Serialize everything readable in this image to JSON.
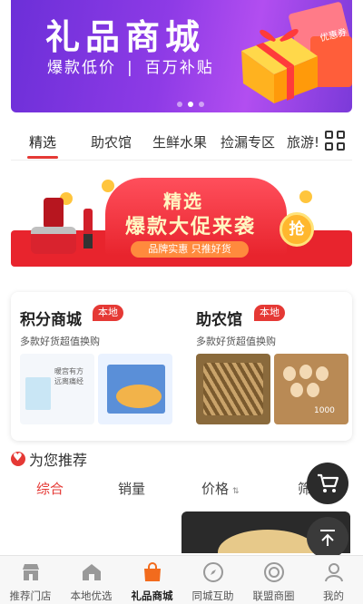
{
  "hero": {
    "title": "礼品商城",
    "subtitle_left": "爆款低价",
    "subtitle_sep": "|",
    "subtitle_right": "百万补贴",
    "ticket_text": "优惠券",
    "slide_count": 3,
    "active_slide": 2
  },
  "tabs": {
    "items": [
      {
        "label": "精选"
      },
      {
        "label": "助农馆"
      },
      {
        "label": "生鲜水果"
      },
      {
        "label": "捡漏专区"
      },
      {
        "label": "旅游!"
      }
    ],
    "active_index": 0
  },
  "promo": {
    "line1": "精选",
    "line2": "爆款大促来袭",
    "pill": "品牌实惠 只推好货",
    "grab": "抢"
  },
  "cards": [
    {
      "title": "积分商城",
      "badge": "本地",
      "desc": "多款好货超值换购",
      "img1_text": "暖宫有方 远离痛经",
      "img2_text": ""
    },
    {
      "title": "助农馆",
      "badge": "本地",
      "desc": "多款好货超值换购",
      "img1_text": "",
      "img2_text": "1000"
    }
  ],
  "recommend": {
    "title": "为您推荐",
    "sort_tabs": [
      {
        "label": "综合"
      },
      {
        "label": "销量"
      },
      {
        "label": "价格"
      },
      {
        "label": "筛选"
      }
    ],
    "active_sort": 0
  },
  "bottom_nav": {
    "items": [
      {
        "label": "推荐门店",
        "icon": "store-icon"
      },
      {
        "label": "本地优选",
        "icon": "home-icon"
      },
      {
        "label": "礼品商城",
        "icon": "shopping-bag-icon"
      },
      {
        "label": "同城互助",
        "icon": "compass-icon"
      },
      {
        "label": "联盟商圈",
        "icon": "circle-icon"
      },
      {
        "label": "我的",
        "icon": "user-icon"
      }
    ],
    "active_index": 2
  },
  "colors": {
    "accent": "#e53935",
    "hero_purple": "#8e3be6",
    "promo_red": "#e8242d"
  }
}
